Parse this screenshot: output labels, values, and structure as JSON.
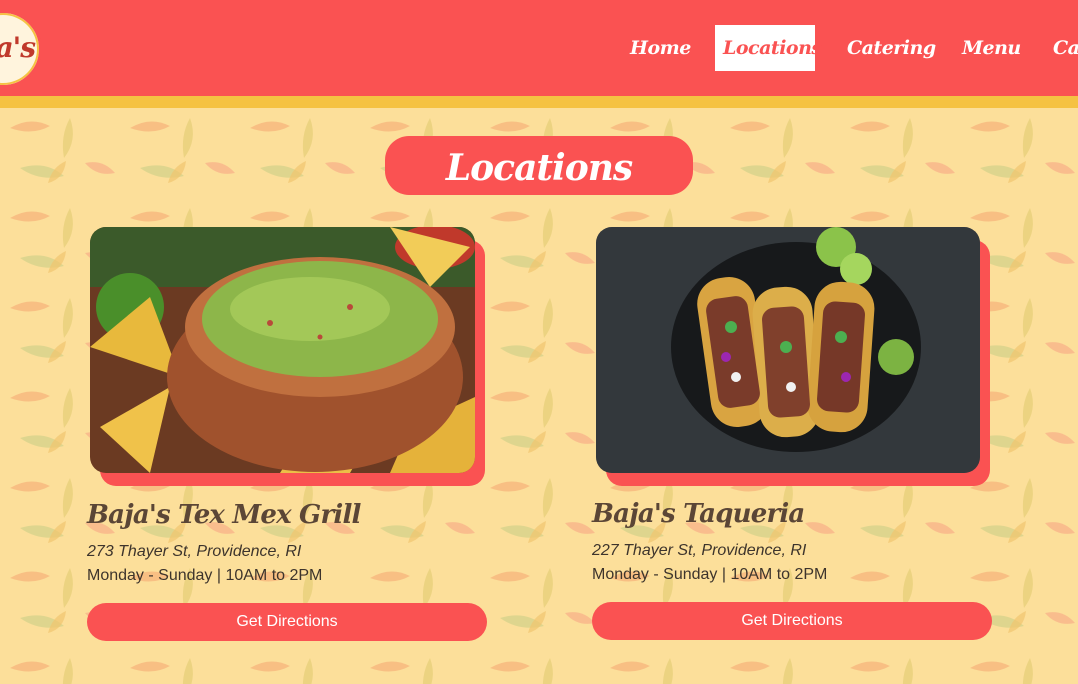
{
  "nav": {
    "logo_text": "a's",
    "items": [
      {
        "label": "Home"
      },
      {
        "label": "Locations",
        "active": true
      },
      {
        "label": "Catering"
      },
      {
        "label": "Menu"
      },
      {
        "label": "Ca"
      }
    ]
  },
  "page_title": "Locations",
  "locations": [
    {
      "name": "Baja's Tex Mex Grill",
      "address": "273 Thayer St, Providence, RI",
      "hours": "Monday - Sunday | 10AM to 2PM",
      "button_label": "Get Directions",
      "image": "guacamole-bowl"
    },
    {
      "name": "Baja's Taqueria",
      "address": "227 Thayer St, Providence, RI",
      "hours": "Monday - Sunday | 10AM to 2PM",
      "button_label": "Get Directions",
      "image": "tacos-plate"
    }
  ],
  "colors": {
    "primary_red": "#fa5252",
    "stripe_yellow": "#f5c242",
    "background": "#fcdf9a",
    "text_brown": "#5b4636"
  }
}
